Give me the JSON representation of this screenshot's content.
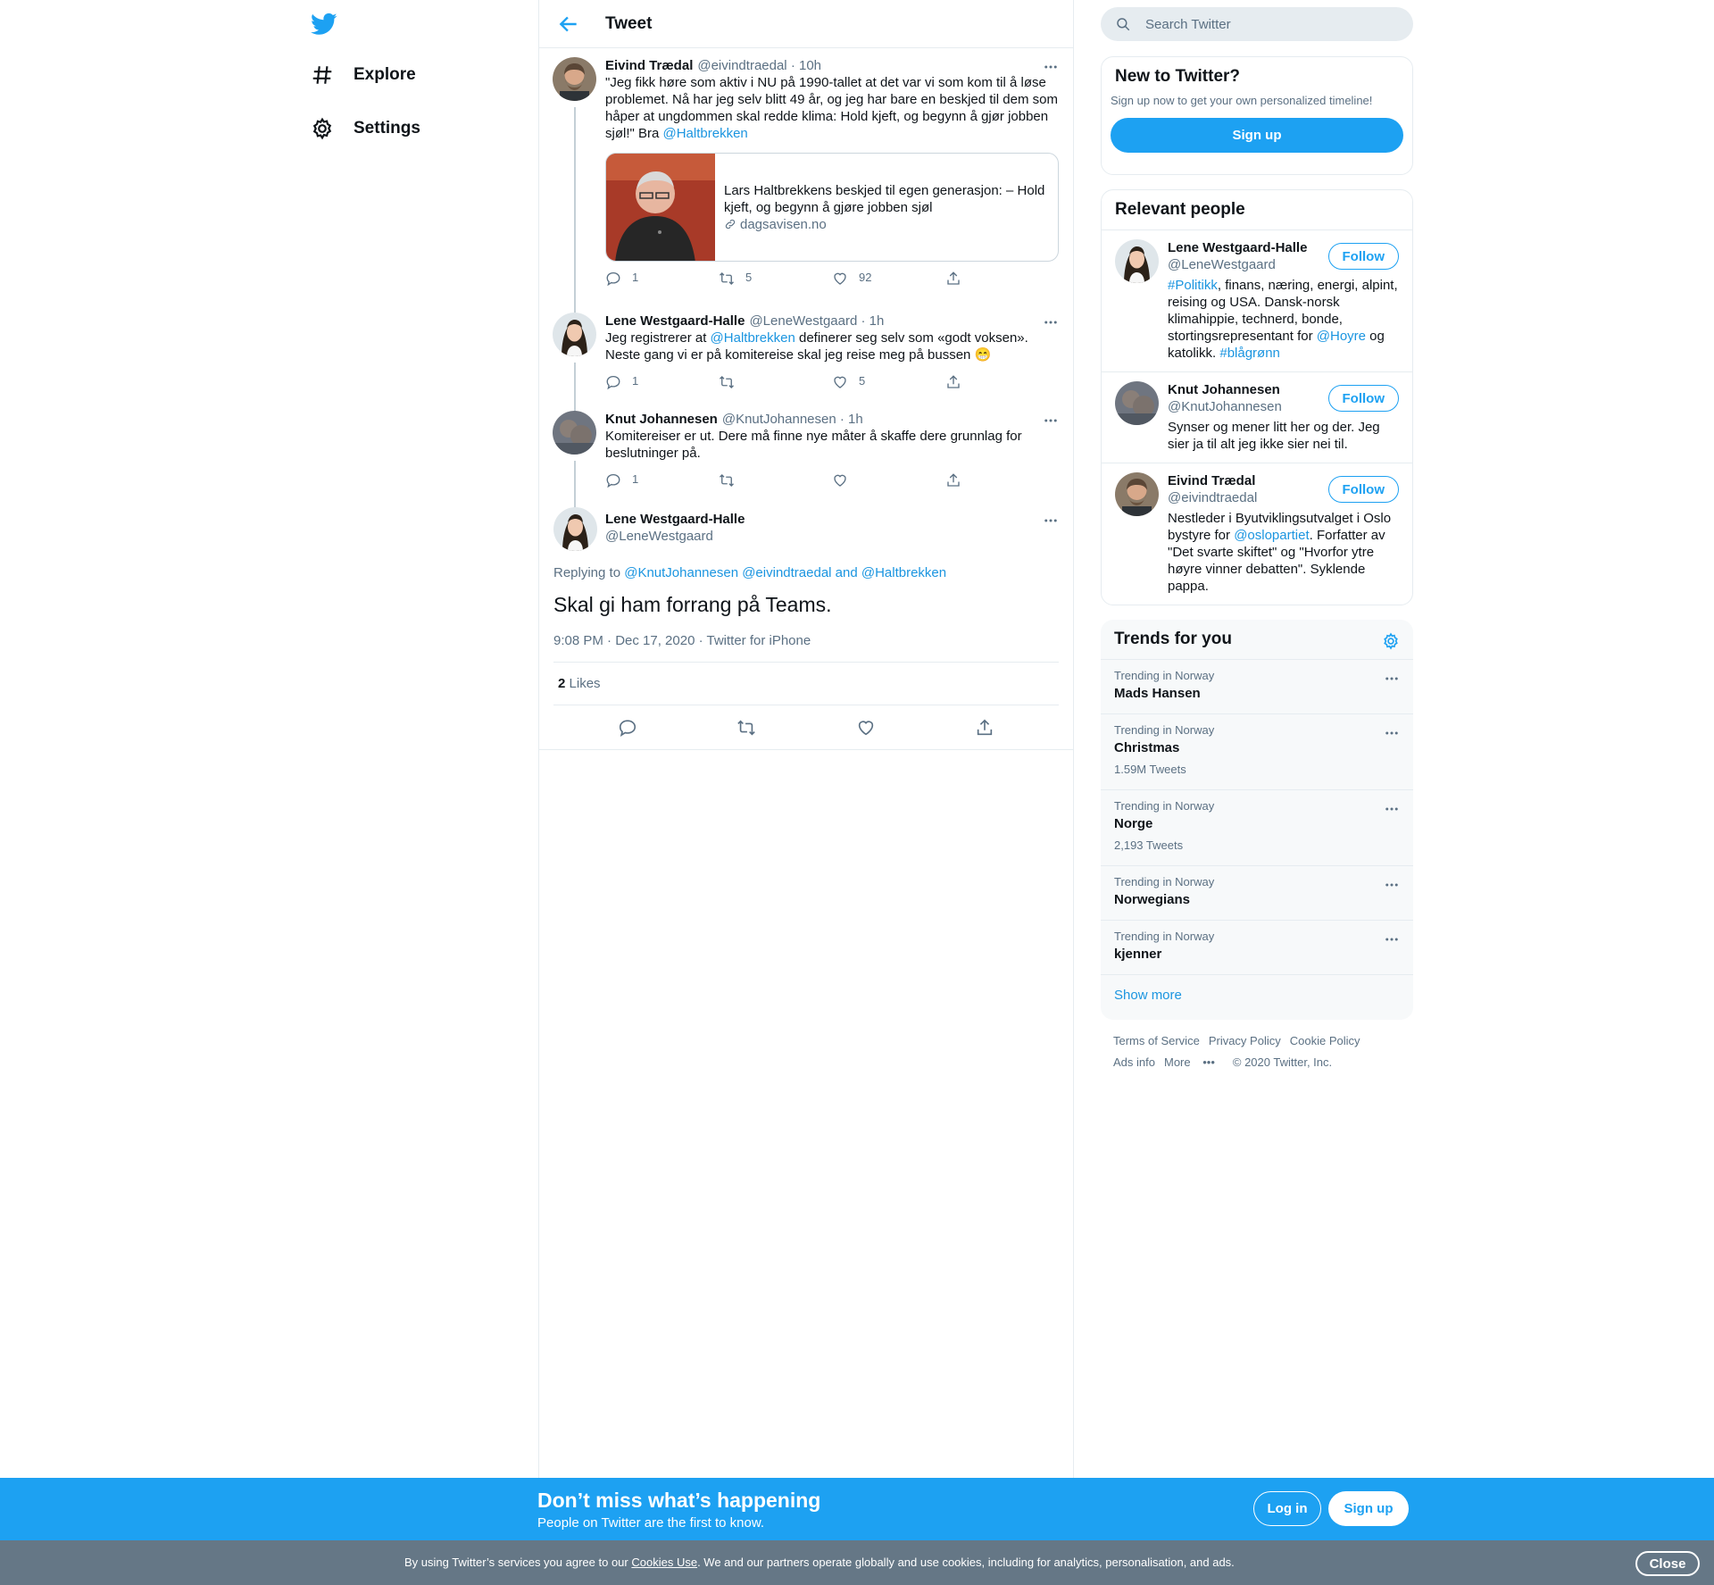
{
  "nav": {
    "explore": "Explore",
    "settings": "Settings"
  },
  "header": {
    "title": "Tweet"
  },
  "thread": [
    {
      "name": "Eivind Trædal",
      "handle": "@eivindtraedal",
      "time": "· 10h",
      "text_parts": [
        "\"Jeg fikk høre som aktiv i NU på 1990-tallet at det var vi som kom til å løse problemet. Nå har jeg selv blitt 49 år, og jeg har bare en beskjed til dem som håper at ungdommen skal redde klima: Hold kjeft, og begynn å gjør jobben sjøl!\" Bra ",
        "@Haltbrekken"
      ],
      "card": {
        "title": "Lars Haltbrekkens beskjed til egen generasjon: – Hold kjeft, og begynn å gjøre jobben sjøl",
        "domain": "dagsavisen.no"
      },
      "replies": "1",
      "retweets": "5",
      "likes": "92"
    },
    {
      "name": "Lene Westgaard-Halle",
      "handle": "@LeneWestgaard",
      "time": "· 1h",
      "text_parts": [
        "Jeg registrerer at ",
        "@Haltbrekken",
        " definerer seg selv som «godt voksen». Neste gang vi er på komitereise skal jeg reise meg på bussen 😁"
      ],
      "replies": "1",
      "retweets": "",
      "likes": "5"
    },
    {
      "name": "Knut Johannesen",
      "handle": "@KnutJohannesen",
      "time": "· 1h",
      "text": "Komitereiser er ut. Dere må finne nye måter å skaffe dere grunnlag for beslutninger på.",
      "replies": "1",
      "retweets": "",
      "likes": ""
    }
  ],
  "main_tweet": {
    "name": "Lene Westgaard-Halle",
    "handle": "@LeneWestgaard",
    "replying_prefix": "Replying to ",
    "replying_to": "@KnutJohannesen @eivindtraedal and @Haltbrekken",
    "text": "Skal gi ham forrang på Teams.",
    "meta": "9:08 PM · Dec 17, 2020 · Twitter for iPhone",
    "like_count": "2",
    "like_label": "Likes"
  },
  "search": {
    "placeholder": "Search Twitter"
  },
  "new_to_twitter": {
    "title": "New to Twitter?",
    "subtitle": "Sign up now to get your own personalized timeline!",
    "button": "Sign up"
  },
  "relevant_people": {
    "title": "Relevant people",
    "follow_label": "Follow",
    "people": [
      {
        "name": "Lene Westgaard-Halle",
        "handle": "@LeneWestgaard",
        "bio_parts": [
          "#Politikk",
          ", finans, næring, energi, alpint, reising og USA. Dansk-norsk klimahippie, technerd, bonde, stortingsrepresentant for ",
          "@Hoyre",
          " og katolikk. ",
          "#blågrønn"
        ]
      },
      {
        "name": "Knut Johannesen",
        "handle": "@KnutJohannesen",
        "bio": "Synser og mener litt her og der. Jeg sier ja til alt jeg ikke sier nei til."
      },
      {
        "name": "Eivind Trædal",
        "handle": "@eivindtraedal",
        "bio_parts": [
          "Nestleder i Byutviklingsutvalget i Oslo bystyre for ",
          "@oslopartiet",
          ". Forfatter av \"Det svarte skiftet\" og \"Hvorfor ytre høyre vinner debatten\". Syklende pappa."
        ]
      }
    ]
  },
  "trends": {
    "title": "Trends for you",
    "items": [
      {
        "context": "Trending in Norway",
        "name": "Mads Hansen",
        "count": ""
      },
      {
        "context": "Trending in Norway",
        "name": "Christmas",
        "count": "1.59M Tweets"
      },
      {
        "context": "Trending in Norway",
        "name": "Norge",
        "count": "2,193 Tweets"
      },
      {
        "context": "Trending in Norway",
        "name": "Norwegians",
        "count": ""
      },
      {
        "context": "Trending in Norway",
        "name": "kjenner",
        "count": ""
      }
    ],
    "show_more": "Show more"
  },
  "footer": {
    "terms": "Terms of Service",
    "privacy": "Privacy Policy",
    "cookie": "Cookie Policy",
    "ads": "Ads info",
    "more": "More",
    "copyright": "© 2020 Twitter, Inc."
  },
  "bottom_bar": {
    "headline": "Don’t miss what’s happening",
    "sub": "People on Twitter are the first to know.",
    "login": "Log in",
    "signup": "Sign up"
  },
  "cookie_bar": {
    "prefix": "By using Twitter’s services you agree to our ",
    "link": "Cookies Use",
    "suffix": ". We and our partners operate globally and use cookies, including for analytics, personalisation, and ads.",
    "close": "Close"
  },
  "colors": {
    "accent": "#1da1f2",
    "link": "#1b95e0",
    "muted": "#5b7083",
    "border": "#e6ecf0",
    "cookie_bg": "#657786"
  }
}
